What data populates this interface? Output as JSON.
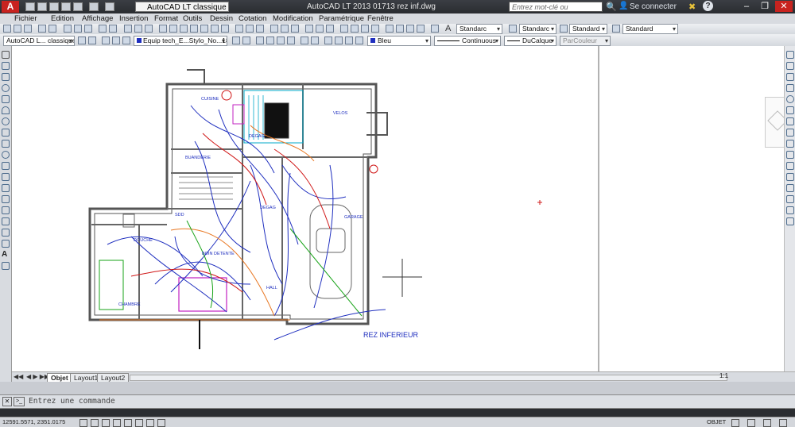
{
  "titlebar": {
    "workspace": "AutoCAD LT classique",
    "title": "AutoCAD LT 2013    01713 rez inf.dwg",
    "search_placeholder": "Entrez mot-clé ou expression",
    "signin": "Se connecter"
  },
  "menu": [
    "Fichier",
    "Edition",
    "Affichage",
    "Insertion",
    "Format",
    "Outils",
    "Dessin",
    "Cotation",
    "Modification",
    "Paramétrique",
    "Fenêtre"
  ],
  "toolbar1": {
    "text_style": "Standarc",
    "dim_style": "Standarc",
    "table_style": "Standard",
    "mleader_style": "Standard"
  },
  "toolbar2": {
    "workspace": "AutoCAD L... classique",
    "layer": "Equip tech_E...Stylo_No...181",
    "color": "Bleu",
    "linetype": "Continuous",
    "lineweight": "DuCalque",
    "plotstyle": "ParCouleur"
  },
  "drawing": {
    "labels": [
      "CUISINE",
      "BUANDERIE",
      "DEGAG",
      "VELOS",
      "GARAGE",
      "DOUCHE",
      "SDD",
      "CHAMBRE",
      "BOIN DETENTE",
      "DEGAG",
      "HALL",
      "REZ INFERIEUR"
    ]
  },
  "tabs": [
    "Objet",
    "Layout1",
    "Layout2"
  ],
  "command": {
    "placeholder": "Entrez une commande"
  },
  "status": {
    "coords": "12591.5571, 2351.0175",
    "mode": "OBJET",
    "scale": "1:1"
  },
  "colors": {
    "blue": "#1f2fbf",
    "red": "#d01818",
    "green": "#17a317",
    "orange": "#e87722",
    "magenta": "#c020c0",
    "cyan": "#00a8c8"
  }
}
